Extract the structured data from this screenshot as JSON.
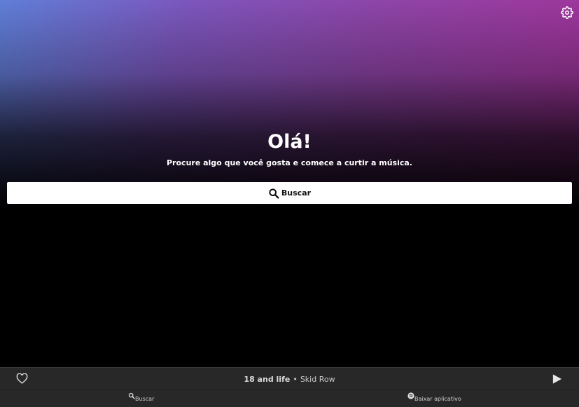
{
  "hero": {
    "greeting": "Olá!",
    "subtitle": "Procure algo que você gosta e comece a curtir a música.",
    "gradient_colors": [
      "#5f7fd8",
      "#7d56bd",
      "#8e45a8",
      "#a2339a"
    ]
  },
  "search": {
    "label": "Buscar",
    "icon": "search-icon"
  },
  "settings": {
    "icon": "gear-icon"
  },
  "player": {
    "track_title": "18 and life",
    "separator": "•",
    "artist": "Skid Row",
    "like_icon": "heart-outline-icon",
    "play_icon": "play-icon"
  },
  "bottom_nav": {
    "items": [
      {
        "label": "Buscar",
        "icon": "search-icon"
      },
      {
        "label": "Baixar aplicativo",
        "icon": "spotify-logo-icon"
      }
    ]
  },
  "colors": {
    "background": "#000000",
    "bar_background": "#282828",
    "search_bar": "#ffffff"
  }
}
